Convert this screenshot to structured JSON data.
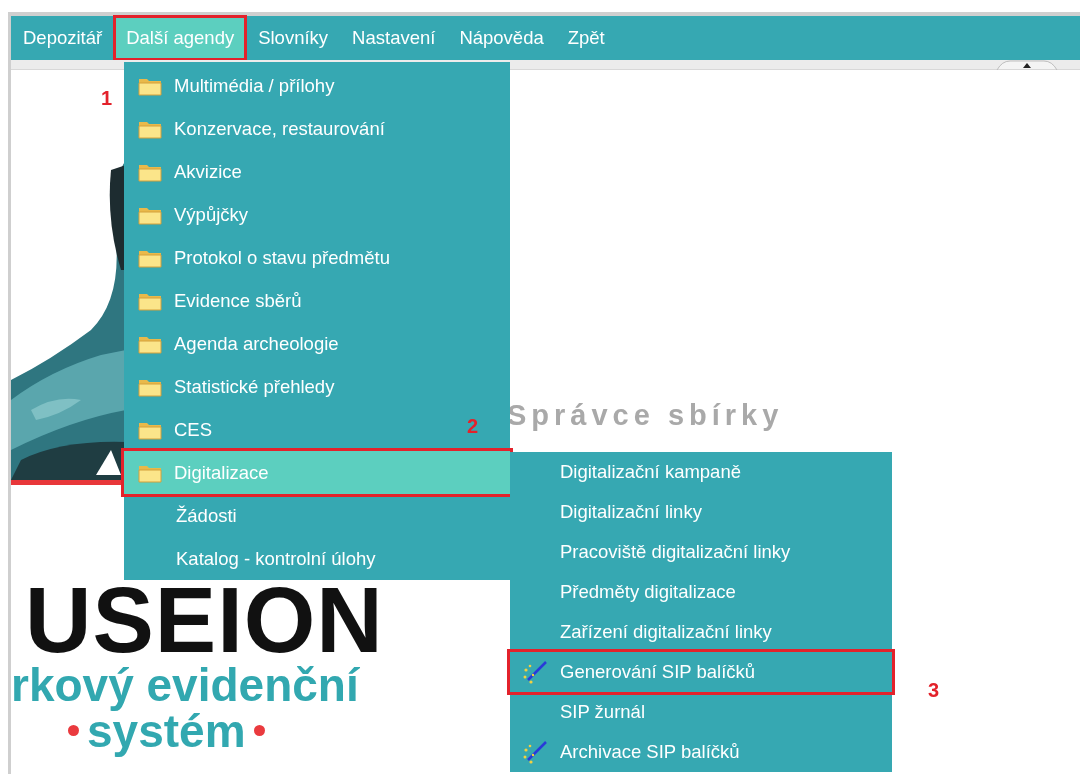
{
  "menubar": [
    {
      "label": "Depozitář",
      "selected": false,
      "annotated": false
    },
    {
      "label": "Další agendy",
      "selected": true,
      "annotated": true
    },
    {
      "label": "Slovníky",
      "selected": false,
      "annotated": false
    },
    {
      "label": "Nastavení",
      "selected": false,
      "annotated": false
    },
    {
      "label": "Nápověda",
      "selected": false,
      "annotated": false
    },
    {
      "label": "Zpět",
      "selected": false,
      "annotated": false
    }
  ],
  "dropdown": [
    {
      "label": "Multimédia / přílohy",
      "kind": "folder",
      "selected": false,
      "annotated": false
    },
    {
      "label": "Konzervace, restaurování",
      "kind": "folder",
      "selected": false,
      "annotated": false
    },
    {
      "label": "Akvizice",
      "kind": "folder",
      "selected": false,
      "annotated": false
    },
    {
      "label": "Výpůjčky",
      "kind": "folder",
      "selected": false,
      "annotated": false
    },
    {
      "label": "Protokol o stavu předmětu",
      "kind": "folder",
      "selected": false,
      "annotated": false
    },
    {
      "label": "Evidence sběrů",
      "kind": "folder",
      "selected": false,
      "annotated": false
    },
    {
      "label": "Agenda archeologie",
      "kind": "folder",
      "selected": false,
      "annotated": false
    },
    {
      "label": "Statistické přehledy",
      "kind": "folder",
      "selected": false,
      "annotated": false
    },
    {
      "label": "CES",
      "kind": "folder",
      "selected": false,
      "annotated": false
    },
    {
      "label": "Digitalizace",
      "kind": "folder",
      "selected": true,
      "annotated": true
    },
    {
      "label": "Žádosti",
      "kind": "plain",
      "selected": false,
      "annotated": false
    },
    {
      "label": "Katalog - kontrolní úlohy",
      "kind": "plain",
      "selected": false,
      "annotated": false
    }
  ],
  "submenu": [
    {
      "label": "Digitalizační kampaně",
      "kind": "plain",
      "annotated": false
    },
    {
      "label": "Digitalizační linky",
      "kind": "plain",
      "annotated": false
    },
    {
      "label": "Pracoviště digitalizační linky",
      "kind": "plain",
      "annotated": false
    },
    {
      "label": "Předměty digitalizace",
      "kind": "plain",
      "annotated": false
    },
    {
      "label": "Zařízení digitalizační linky",
      "kind": "plain",
      "annotated": false
    },
    {
      "label": "Generování SIP balíčků",
      "kind": "wand",
      "annotated": true
    },
    {
      "label": "SIP žurnál",
      "kind": "plain",
      "annotated": false
    },
    {
      "label": "Archivace SIP balíčků",
      "kind": "wand",
      "annotated": false
    }
  ],
  "annotations": [
    "1",
    "2",
    "3"
  ],
  "logo": {
    "title": "USEION",
    "line_1": "rkový evidenční",
    "line_2": "systém"
  },
  "heading": "Správce sbírky"
}
